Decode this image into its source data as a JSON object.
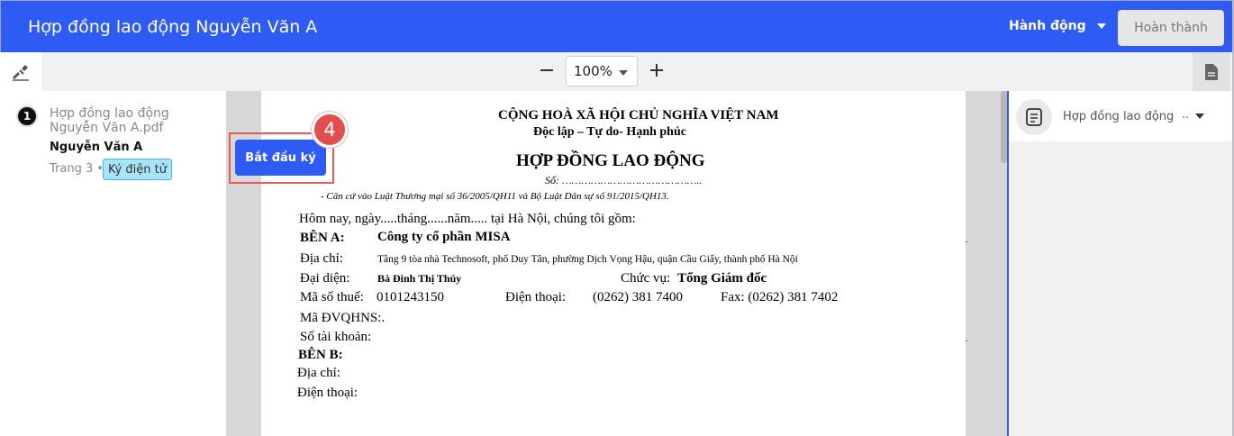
{
  "header": {
    "title": "Hợp đồng lao động Nguyễn Văn A",
    "action_label": "Hành động",
    "finish_label": "Hoàn thành"
  },
  "toolbar": {
    "zoom": "100%"
  },
  "sidebar": {
    "doc_number": "1",
    "doc_name": "Hợp đồng lao động Nguyễn Văn A.pdf",
    "signer": "Nguyễn Văn A",
    "page_info": "Trang 3 •",
    "sign_type": "Ký điện tử"
  },
  "overlay": {
    "start_sign_label": "Bắt đầu ký",
    "step_number": "4"
  },
  "document": {
    "nation": "CỘNG HOÀ XÃ HỘI CHỦ NGHĨA VIỆT NAM",
    "motto": "Độc lập – Tự do- Hạnh phúc",
    "title": "HỢP ĐỒNG LAO ĐỘNG",
    "number_line": "Số: ……………………………………..",
    "basis": "-  Căn cứ vào Luật Thương mại số 36/2005/QH11 và Bộ Luật Dân sự số 91/2015/QH13.",
    "intro": "Hôm nay, ngày.....tháng......năm..... tại Hà Nội, chúng tôi gồm:",
    "party_a_label": "BÊN A:",
    "party_a_name": "Công ty cổ phần MISA",
    "address_label": "Địa chỉ:",
    "address_value": "Tầng 9 tòa nhà Technosoft, phố Duy Tân, phường Dịch Vọng Hậu, quận Cầu Giấy, thành phố Hà Nội",
    "rep_label": "Đại diện:",
    "rep_value": "Bà Đinh Thị Thúy",
    "position_label": "Chức vụ:",
    "position_value": "Tổng Giám đốc",
    "tax_label": "Mã số thuế:",
    "tax_value": "0101243150",
    "phone_label": "Điện thoại:",
    "phone_value": "(0262) 381 7400",
    "fax_text": "Fax: (0262) 381 7402",
    "budget_code": "Mã ĐVQHNS:.",
    "account": "Số  tài khoản:",
    "party_b_label": "BÊN B:",
    "b_address": "Địa chỉ:",
    "b_phone": "Điện thoại:"
  },
  "right_panel": {
    "title": "Hợp đồng lao động",
    "more": ".."
  }
}
